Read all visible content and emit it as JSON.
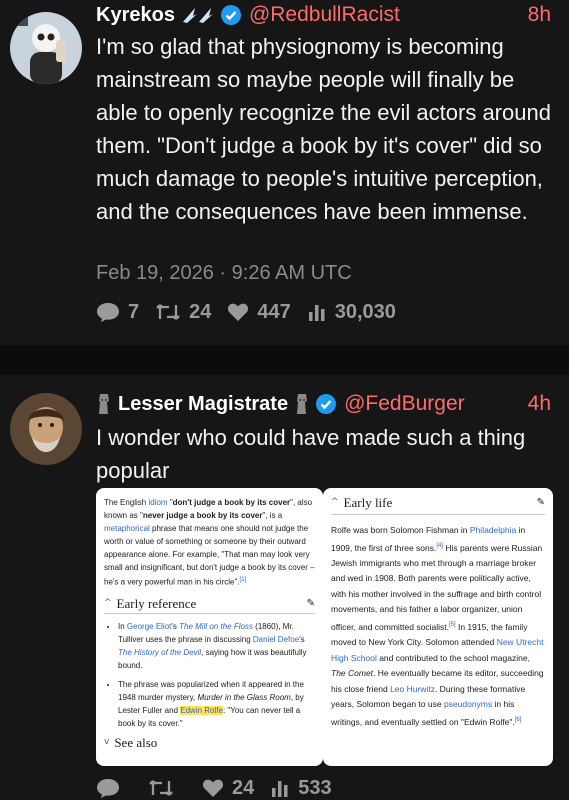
{
  "post1": {
    "name": "Kyrekos",
    "handle": "@RedbullRacist",
    "time": "8h",
    "text": "I'm so glad that physiognomy is becoming mainstream so maybe people will finally be able to openly recognize the evil actors around them. \"Don't judge a book by it's cover\" did so much damage to people's intuitive perception, and the consequences have been immense.",
    "date": "Feb 19, 2026 · 9:26 AM UTC",
    "replies": "7",
    "retweets": "24",
    "likes": "447",
    "views": "30,030"
  },
  "post2": {
    "name": "Lesser Magistrate",
    "handle": "@FedBurger",
    "time": "4h",
    "text": "I wonder who could have made such a thing popular",
    "replies": "",
    "retweets": "",
    "likes": "24",
    "views": "533",
    "left_image": {
      "intro_1": "The English ",
      "intro_idiom": "idiom",
      "intro_2": " \"",
      "intro_bold1": "don't judge a book by its cover",
      "intro_3": "\", also known as \"",
      "intro_bold2": "never judge a book by its cover",
      "intro_4": "\", is a ",
      "intro_metaphorical": "metaphorical",
      "intro_5": " phrase that means one should not judge the worth or value of something or someone by their outward appearance alone. For example, \"That man may look very small and insignificant, but don't judge a book by its cover – he's a very powerful man in his circle\".",
      "intro_ref": "[1]",
      "heading": "Early reference",
      "li1_a": "In ",
      "li1_eliot": "George Eliot",
      "li1_b": "'s ",
      "li1_mill": "The Mill on the Floss",
      "li1_c": " (1860), Mr. Tulliver uses the phrase in discussing ",
      "li1_defoe": "Daniel Defoe",
      "li1_d": "'s ",
      "li1_devil": "The History of the Devil",
      "li1_e": ", saying how it was beautifully bound.",
      "li2_a": "The phrase was popularized when it appeared in the 1948 murder mystery, ",
      "li2_murder": "Murder in the Glass Room",
      "li2_b": ", by Lester Fuller and ",
      "li2_rolfe": "Edwin Rolfe",
      "li2_c": ": \"You can never tell a book by its cover.\"",
      "see_also": "See also"
    },
    "right_image": {
      "heading": "Early life",
      "p_a": "Rolfe was born Solomon Fishman in ",
      "p_phil": "Philadelphia",
      "p_b": " in 1909, the first of three sons.",
      "ref4": "[4]",
      "p_c": " His parents were Russian Jewish immigrants who met through a marriage broker and wed in 1908. Both parents were politically active, with his mother involved in the suffrage and birth control movements, and his father a labor organizer, union officer, and committed socialist.",
      "ref5": "[5]",
      "p_d": " In 1915, the family moved to New York City. Solomon attended ",
      "p_school": "New Utrecht High School",
      "p_e": " and contributed to the school magazine, ",
      "p_comet": "The Comet",
      "p_f": ". He eventually became its editor, succeeding his close friend ",
      "p_leo": "Leo Hurwitz",
      "p_g": ". During these formative years, Solomon began to use ",
      "p_pseud": "pseudonyms",
      "p_h": " in his writings, and eventually settled on \"Edwin Rolfe\".",
      "ref6": "[6]"
    }
  },
  "icons": {
    "reply": "reply-icon",
    "retweet": "retweet-icon",
    "like": "heart-icon",
    "views": "views-icon",
    "verified": "verified-badge-icon",
    "flair1": "wing-icon",
    "flair2": "moai-icon"
  },
  "colors": {
    "handle": "#ff6b6b",
    "verified": "#1d9bf0",
    "background": "#161616",
    "highlight": "#ffe45c"
  }
}
